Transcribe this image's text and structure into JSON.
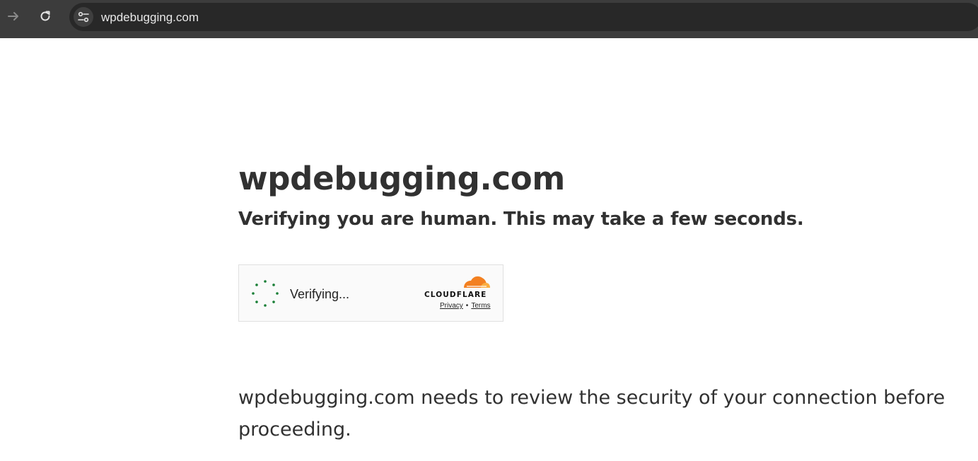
{
  "browser": {
    "url": "wpdebugging.com",
    "icons": {
      "forward": "arrow-right-icon",
      "reload": "reload-icon",
      "site_info": "tune-icon"
    }
  },
  "page": {
    "heading": "wpdebugging.com",
    "subheading": "Verifying you are human. This may take a few seconds.",
    "description": "wpdebugging.com needs to review the security of your connection before proceeding."
  },
  "widget": {
    "status": "Verifying...",
    "brand": "CLOUDFLARE",
    "privacy_label": "Privacy",
    "separator": "•",
    "terms_label": "Terms",
    "colors": {
      "spinner": "#1a7f37",
      "cloud_orange": "#f38020",
      "cloud_light": "#faae40"
    }
  }
}
